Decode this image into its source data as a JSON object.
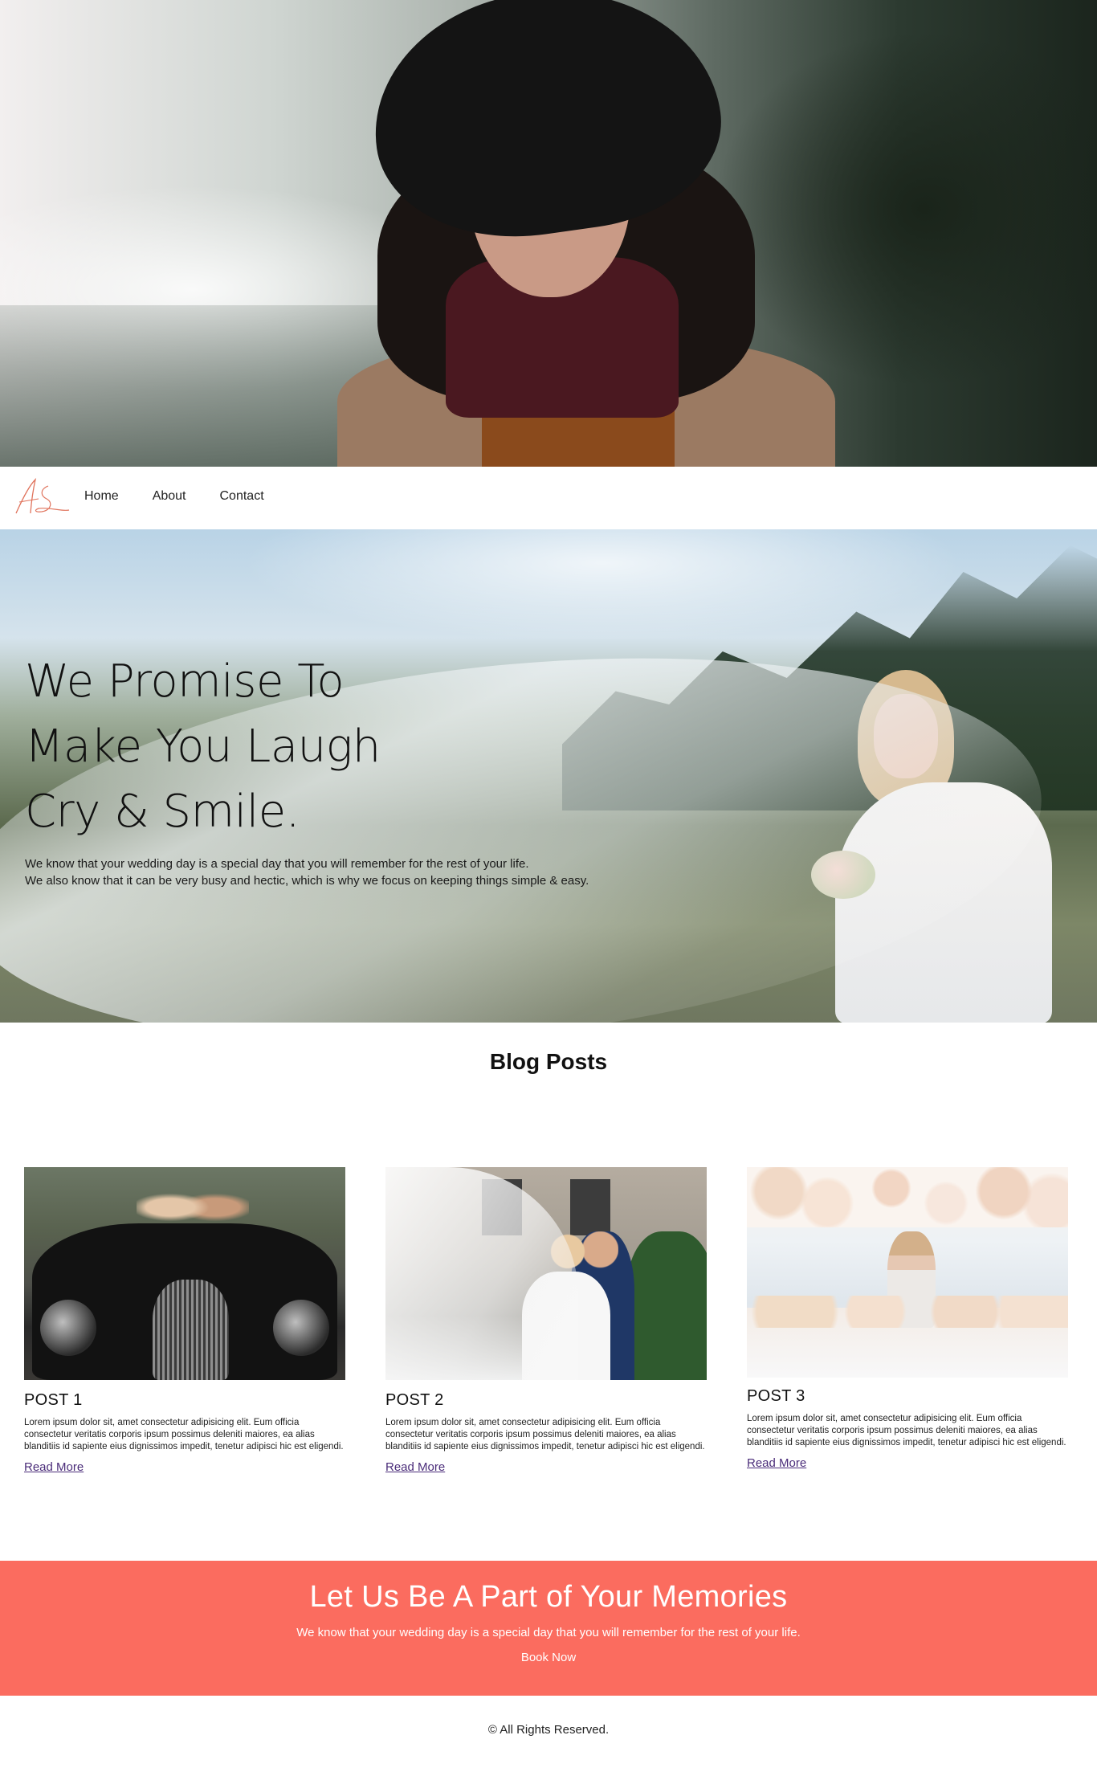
{
  "nav": {
    "logo_alt": "AS signature logo",
    "links": [
      "Home",
      "About",
      "Contact"
    ]
  },
  "hero": {
    "heading_lines": [
      "We Promise To",
      "Make You Laugh",
      "Cry & Smile."
    ],
    "subtext_lines": [
      "We know that your wedding day is a special day that you will remember for the rest of your life.",
      "We also know that it can be very busy and hectic, which is why we focus on keeping things simple & easy."
    ]
  },
  "blog": {
    "title": "Blog Posts",
    "posts": [
      {
        "title": "POST 1",
        "body": "Lorem ipsum dolor sit, amet consectetur adipisicing elit. Eum officia consectetur veritatis corporis ipsum possimus deleniti maiores, ea alias blanditiis id sapiente eius dignissimos impedit, tenetur adipisci hic est eligendi.",
        "link": "Read More"
      },
      {
        "title": "POST 2",
        "body": "Lorem ipsum dolor sit, amet consectetur adipisicing elit. Eum officia consectetur veritatis corporis ipsum possimus deleniti maiores, ea alias blanditiis id sapiente eius dignissimos impedit, tenetur adipisci hic est eligendi.",
        "link": "Read More"
      },
      {
        "title": "POST 3",
        "body": "Lorem ipsum dolor sit, amet consectetur adipisicing elit. Eum officia consectetur veritatis corporis ipsum possimus deleniti maiores, ea alias blanditiis id sapiente eius dignissimos impedit, tenetur adipisci hic est eligendi.",
        "link": "Read More"
      }
    ]
  },
  "cta": {
    "title": "Let Us Be A Part of Your Memories",
    "subtitle": "We know that your wedding day is a special day that you will remember for the rest of your life.",
    "button": "Book Now"
  },
  "footer": {
    "text": "© All Rights Reserved."
  },
  "colors": {
    "cta_background": "#fb6c5f",
    "link": "#4b2d7a",
    "logo_stroke": "#e0735c"
  }
}
